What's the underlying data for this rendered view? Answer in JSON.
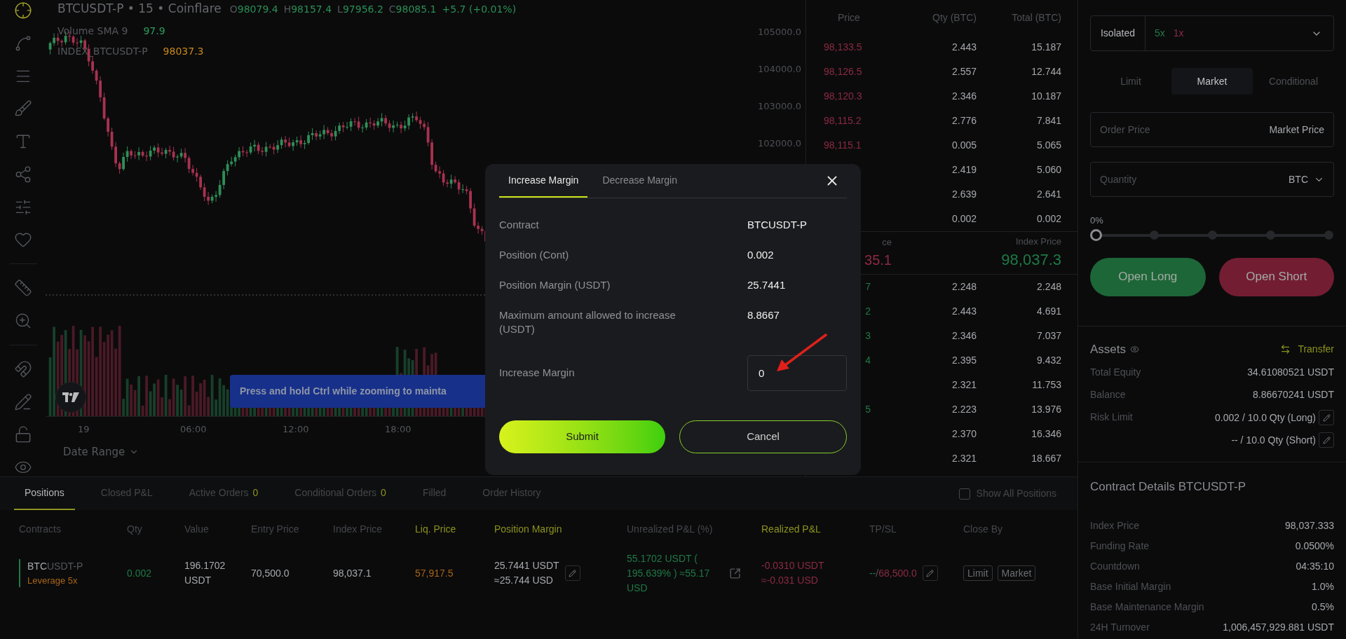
{
  "chart": {
    "symbol_line": "BTCUSDT-P • 15 • Coinflare",
    "ohlc": [
      {
        "letter": "O",
        "value": "98079.4"
      },
      {
        "letter": "H",
        "value": "98157.4"
      },
      {
        "letter": "L",
        "value": "97956.2"
      },
      {
        "letter": "C",
        "value": "98085.1"
      }
    ],
    "change": "+5.7 (+0.01%)",
    "indicators": [
      {
        "name": "Volume SMA 9",
        "value": "97.9",
        "color": "#2e9e5b"
      },
      {
        "name": "INDEX_BTCUSDT-P",
        "value": "98037.3",
        "color": "#c98a1a"
      }
    ],
    "price_axis": [
      "105000.0",
      "104000.0",
      "103000.0",
      "102000.0"
    ],
    "time_axis": [
      "19",
      "06:00",
      "12:00",
      "18:00"
    ],
    "date_range": "Date Range",
    "tooltip": "Press and hold Ctrl while zooming to mainta"
  },
  "order_book": {
    "columns": [
      "Price",
      "Qty (BTC)",
      "Total (BTC)"
    ],
    "asks": [
      {
        "price": "98,133.5",
        "qty": "2.443",
        "total": "15.187"
      },
      {
        "price": "98,126.5",
        "qty": "2.557",
        "total": "12.744"
      },
      {
        "price": "98,120.3",
        "qty": "2.346",
        "total": "10.187"
      },
      {
        "price": "98,115.2",
        "qty": "2.776",
        "total": "7.841"
      },
      {
        "price": "98,115.1",
        "qty": "0.005",
        "total": "5.065"
      },
      {
        "qty": "2.419",
        "total": "5.060"
      },
      {
        "qty": "2.639",
        "total": "2.641"
      },
      {
        "qty": "0.002",
        "total": "0.002"
      }
    ],
    "mid": {
      "label": "ce",
      "last_price": "35.1",
      "index_label": "Index Price",
      "index_price": "98,037.3"
    },
    "bids": [
      {
        "price": "7",
        "qty": "2.248",
        "total": "2.248"
      },
      {
        "price": "2",
        "qty": "2.443",
        "total": "4.691"
      },
      {
        "price": "3",
        "qty": "2.346",
        "total": "7.037"
      },
      {
        "price": "4",
        "qty": "2.395",
        "total": "9.432"
      },
      {
        "qty": "2.321",
        "total": "11.753"
      },
      {
        "price": "5",
        "qty": "2.223",
        "total": "13.976"
      },
      {
        "qty": "2.370",
        "total": "16.346"
      },
      {
        "qty": "2.321",
        "total": "18.667"
      }
    ]
  },
  "order_form": {
    "margin_mode": "Isolated",
    "leverage_long": "5x",
    "leverage_short": "1x",
    "order_types": [
      {
        "label": "Limit",
        "selected": false
      },
      {
        "label": "Market",
        "selected": true
      },
      {
        "label": "Conditional",
        "selected": false
      }
    ],
    "order_price": {
      "label": "Order Price",
      "value": "Market Price"
    },
    "quantity": {
      "placeholder": "Quantity",
      "unit": "BTC"
    },
    "percent": "0%",
    "slider": {
      "level": 0
    },
    "buttons": [
      {
        "label": "Open Long",
        "kind": "long"
      },
      {
        "label": "Open Short",
        "kind": "short"
      }
    ]
  },
  "assets": {
    "title": "Assets",
    "transfer": "Transfer",
    "rows": [
      {
        "label": "Total Equity",
        "value": "34.61080521 USDT"
      },
      {
        "label": "Balance",
        "value": "8.86670241 USDT"
      },
      {
        "label": "Risk Limit",
        "value": "0.002 / 10.0 Qty (Long)",
        "editable": true
      },
      {
        "value": "-- / 10.0 Qty (Short)",
        "editable": true
      }
    ]
  },
  "contract_details": {
    "title": "Contract Details BTCUSDT-P",
    "rows": [
      {
        "label": "Index Price",
        "value": "98,037.333"
      },
      {
        "label": "Funding Rate",
        "value": "0.0500%"
      },
      {
        "label": "Countdown",
        "value": "04:35:10"
      },
      {
        "label": "Base Initial Margin",
        "value": "1.0%"
      },
      {
        "label": "Base Maintenance Margin",
        "value": "0.5%"
      },
      {
        "label": "24H Turnover",
        "value": "1,006,457,929.881 USDT"
      }
    ]
  },
  "positions_panel": {
    "tabs": [
      {
        "label": "Positions",
        "selected": true
      },
      {
        "label": "Closed P&L",
        "selected": false
      },
      {
        "label": "Active Orders",
        "count": "0",
        "selected": false
      },
      {
        "label": "Conditional Orders",
        "count": "0",
        "selected": false
      },
      {
        "label": "Filled",
        "selected": false
      },
      {
        "label": "Order History",
        "selected": false
      }
    ],
    "show_all": {
      "label": "Show All Positions",
      "checked": false
    },
    "columns": [
      {
        "label": "Contracts",
        "highlighted": false
      },
      {
        "label": "Qty",
        "highlighted": false
      },
      {
        "label": "Value",
        "highlighted": false
      },
      {
        "label": "Entry Price",
        "highlighted": false
      },
      {
        "label": "Index Price",
        "highlighted": false
      },
      {
        "label": "Liq. Price",
        "highlighted": true
      },
      {
        "label": "Position Margin",
        "highlighted": true
      },
      {
        "label": "Unrealized P&L (%)",
        "highlighted": false
      },
      {
        "label": "Realized P&L",
        "highlighted": true
      },
      {
        "label": "TP/SL",
        "highlighted": false
      },
      {
        "label": "Close By",
        "highlighted": false
      }
    ],
    "rows": [
      {
        "base": "BTC",
        "quote": "USDT-P",
        "leverage": "Leverage 5x",
        "qty": "0.002",
        "value": "196.1702 USDT",
        "entry_price": "70,500.0",
        "index_price": "98,037.1",
        "liq_price": "57,917.5",
        "position_margin": [
          "25.7441 USDT",
          "≈25.744 USD"
        ],
        "unrealized_pnl": "55.1702 USDT ( 195.639% ) ≈55.17 USD",
        "realized_pnl": [
          "-0.0310 USDT",
          "≈-0.031 USD"
        ],
        "tp": "--",
        "tp_sl_separator": "/",
        "sl": "68,500.0",
        "close_by": [
          "Limit",
          "Market"
        ]
      }
    ]
  },
  "margin_dialog": {
    "tabs": [
      {
        "label": "Increase Margin",
        "selected": true
      },
      {
        "label": "Decrease Margin",
        "selected": false
      }
    ],
    "rows": [
      {
        "label": "Contract",
        "value": "BTCUSDT-P"
      },
      {
        "label": "Position (Cont)",
        "value": "0.002"
      },
      {
        "label": "Position Margin (USDT)",
        "value": "25.7441"
      },
      {
        "label": "Maximum amount allowed to increase (USDT)",
        "value": "8.8667"
      }
    ],
    "input": {
      "label": "Increase Margin",
      "value": "0"
    },
    "buttons": [
      {
        "label": "Submit",
        "kind": "primary"
      },
      {
        "label": "Cancel",
        "kind": "secondary"
      }
    ]
  }
}
